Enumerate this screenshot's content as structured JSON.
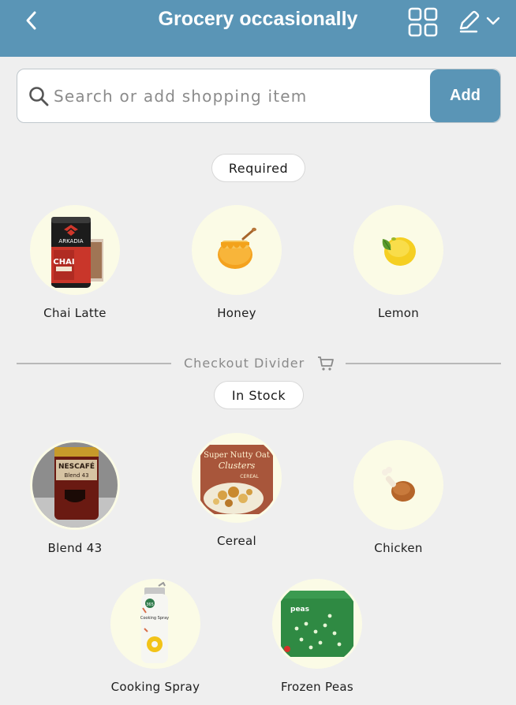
{
  "header": {
    "title": "Grocery occasionally",
    "back_icon": "chevron-left-icon",
    "grid_icon": "grid-view-icon",
    "edit_icon": "pencil-edit-icon",
    "dropdown_icon": "chevron-down-icon",
    "background_color": "#5a95b6"
  },
  "search": {
    "placeholder": "Search or add shopping item",
    "value": "",
    "add_label": "Add"
  },
  "sections": {
    "required": {
      "label": "Required",
      "items": [
        {
          "label": "Chai Latte",
          "icon": "chai-latte-can-image"
        },
        {
          "label": "Honey",
          "icon": "honey-pot-icon"
        },
        {
          "label": "Lemon",
          "icon": "lemon-icon"
        }
      ]
    },
    "divider": {
      "label": "Checkout Divider",
      "icon": "cart-icon"
    },
    "in_stock": {
      "label": "In Stock",
      "items": [
        {
          "label": "Blend 43",
          "icon": "coffee-jar-image"
        },
        {
          "label": "Cereal",
          "icon": "cereal-box-image"
        },
        {
          "label": "Chicken",
          "icon": "chicken-leg-icon"
        },
        {
          "label": "Cooking Spray",
          "icon": "cooking-spray-image"
        },
        {
          "label": "Frozen Peas",
          "icon": "frozen-peas-bag-image"
        }
      ]
    }
  },
  "product_text": {
    "chai_brand": "ARKADIA",
    "chai_name": "CHAI",
    "coffee_brand": "NESCAFÉ",
    "coffee_name": "Blend 43",
    "cereal_name": "Super Nutty Oat",
    "cereal_sub": "Clusters",
    "cereal_word": "CEREAL",
    "spray_brand": "365",
    "spray_name": "Cooking Spray",
    "peas_name": "peas"
  },
  "colors": {
    "accent": "#5a95b6",
    "background": "#efefef",
    "item_circle": "#fbfbe6"
  }
}
